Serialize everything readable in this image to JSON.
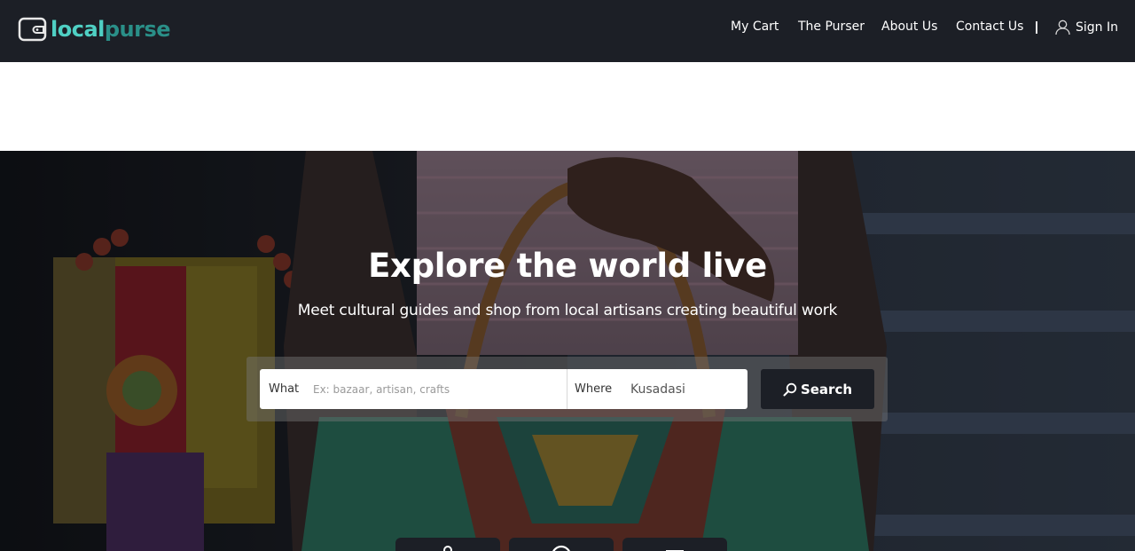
{
  "brand": {
    "name_part1": "local",
    "name_part2": "purse"
  },
  "nav": {
    "items": [
      {
        "label": "My Cart"
      },
      {
        "label": "The Purser"
      },
      {
        "label": "About Us"
      },
      {
        "label": "Contact Us"
      }
    ],
    "sign_in": "Sign In"
  },
  "hero": {
    "title": "Explore the world live",
    "subtitle": "Meet cultural guides and shop from local artisans creating beautiful work"
  },
  "search": {
    "what_label": "What",
    "what_placeholder": "Ex: bazaar, artisan, crafts",
    "what_value": "",
    "where_label": "Where",
    "where_value": "Kusadasi",
    "button_label": "Search"
  },
  "categories": [
    {
      "icon": "map-pin-icon"
    },
    {
      "icon": "compass-icon"
    },
    {
      "icon": "shop-icon"
    }
  ],
  "colors": {
    "header_bg": "#1c1f26",
    "brand_teal": "#4fd0c4",
    "brand_teal_dark": "#2a8f88"
  }
}
